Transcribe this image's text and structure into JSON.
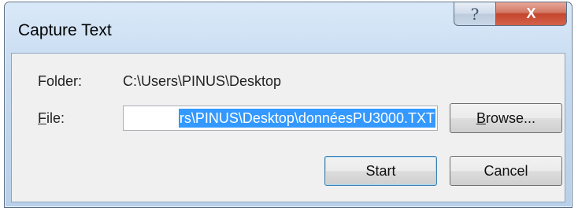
{
  "window": {
    "title": "Capture Text",
    "help_glyph": "?",
    "close_glyph": "X",
    "help_icon": "help-icon",
    "close_icon": "close-icon"
  },
  "form": {
    "folder_label": "Folder:",
    "folder_value": "C:\\Users\\PINUS\\Desktop",
    "file_label_first": "F",
    "file_label_rest": "ile:",
    "file_value_visible": "rs\\PINUS\\Desktop\\donnéesPU3000.TXT"
  },
  "buttons": {
    "browse_first": "B",
    "browse_rest": "rowse...",
    "start_label": "Start",
    "cancel_label": "Cancel"
  },
  "colors": {
    "selection": "#3399ff",
    "close_red": "#c4452d",
    "title_bar": "#c4d9ef"
  }
}
